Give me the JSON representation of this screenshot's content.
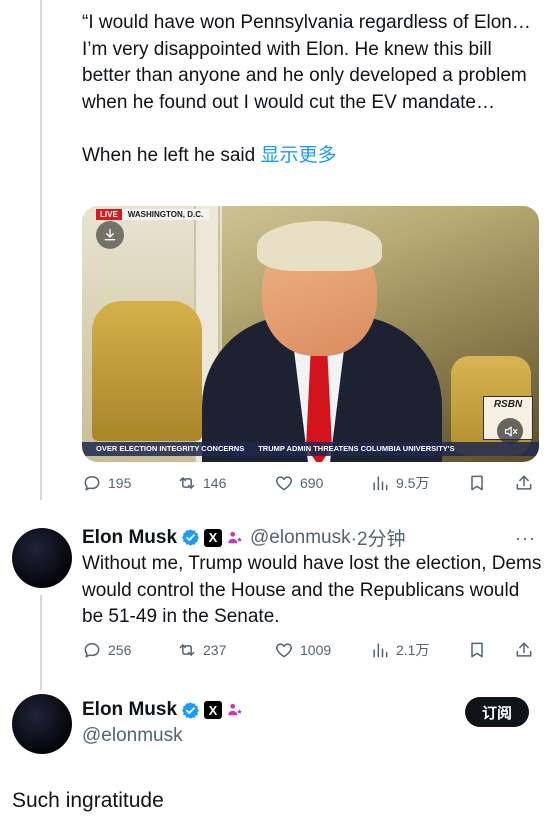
{
  "quoted": {
    "text_main": "“I would have won Pennsylvania regardless of Elon…I’m very disappointed with Elon. He knew this bill better than anyone and he only developed a problem when he found out I would cut the EV mandate…",
    "text_tail": "When he left he said ",
    "show_more": "显示更多",
    "video": {
      "live_label": "LIVE",
      "location": "WASHINGTON, D.C.",
      "logo_text": "RSBN",
      "ticker_1": "OVER ELECTION INTEGRITY CONCERNS",
      "ticker_2": "TRUMP ADMIN THREATENS COLUMBIA UNIVERSITY'S"
    },
    "stats": {
      "replies": "195",
      "reposts": "146",
      "likes": "690",
      "views": "9.5万"
    }
  },
  "reply": {
    "author_name": "Elon Musk",
    "handle": "@elonmusk",
    "time": "·2分钟",
    "more": "···",
    "text": "Without me, Trump would have lost the election, Dems would control the House and the Republicans would be 51-49 in the Senate.",
    "stats": {
      "replies": "256",
      "reposts": "237",
      "likes": "1009",
      "views": "2.1万"
    }
  },
  "main": {
    "author_name": "Elon Musk",
    "handle": "@elonmusk",
    "subscribe_label": "订阅",
    "text": "Such ingratitude"
  },
  "icons": {
    "verified": "verified-badge-icon",
    "x_badge": "X",
    "affiliation": "affiliation-icon",
    "reply": "reply-icon",
    "repost": "repost-icon",
    "like": "heart-icon",
    "views": "views-icon",
    "bookmark": "bookmark-icon",
    "share": "share-icon"
  },
  "colors": {
    "accent": "#1d9bf0",
    "secondary_text": "#536471",
    "affiliation": "#c13bc2",
    "live_red": "#d01d22"
  }
}
